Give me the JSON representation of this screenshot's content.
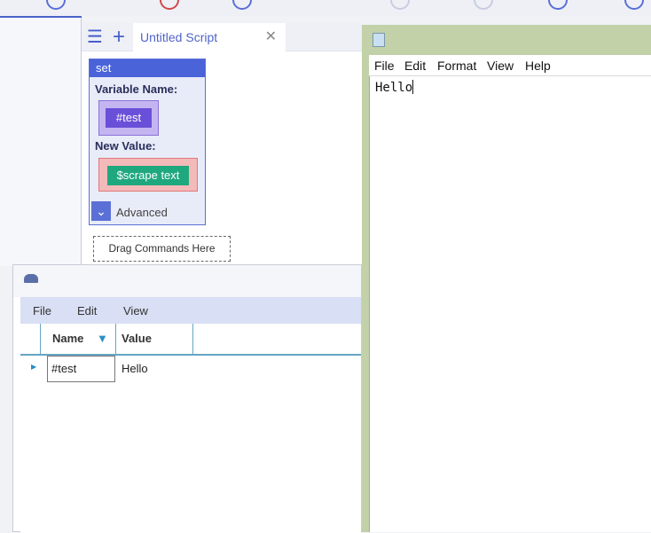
{
  "editor": {
    "tab_title": "Untitled Script",
    "menu_icon": "☰",
    "add_icon": "+",
    "close_icon": "✕",
    "set_block": {
      "command": "set",
      "variable_name_label": "Variable Name:",
      "variable": "#test",
      "new_value_label": "New Value:",
      "value": "$scrape text",
      "advanced_label": "Advanced",
      "advanced_icon": "⌄"
    },
    "drop_zone": "Drag Commands Here"
  },
  "variables_window": {
    "menu": [
      "File",
      "Edit",
      "View"
    ],
    "columns": [
      "Name",
      "Value"
    ],
    "filter_icon": "▼",
    "rows": [
      {
        "name": "#test",
        "value": "Hello"
      }
    ]
  },
  "notepad": {
    "menu": [
      "File",
      "Edit",
      "Format",
      "View",
      "Help"
    ],
    "content": "Hello"
  },
  "colors": {
    "accent": "#4a63d9",
    "variable_chip": "#6a4fd8",
    "value_chip": "#1fa87e",
    "notepad_frame": "#c2d1a8"
  }
}
